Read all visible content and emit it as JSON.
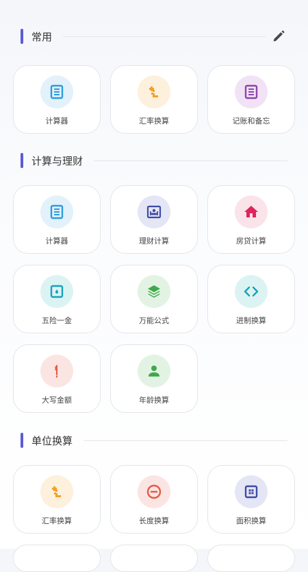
{
  "sections": {
    "common": {
      "title": "常用",
      "items": [
        "计算器",
        "汇率换算",
        "记账和备忘"
      ]
    },
    "calc_finance": {
      "title": "计算与理财",
      "items": [
        "计算器",
        "理财计算",
        "房贷计算",
        "五险一金",
        "万能公式",
        "进制换算",
        "大写金额",
        "年龄换算"
      ]
    },
    "units": {
      "title": "单位换算",
      "items": [
        "汇率换算",
        "长度换算",
        "面积换算"
      ]
    }
  },
  "colors": {
    "section_bar": "#5b5bd6",
    "blue": "#2d9cdb",
    "orange": "#f2a12a",
    "purple": "#8e44ad",
    "navy": "#3f4aa5",
    "pink": "#e0245e",
    "teal": "#17a2b8",
    "green": "#3fa94a",
    "red": "#e45a47"
  },
  "icons": {
    "edit": "pencil-icon",
    "calculator": "calculator-icon",
    "exchange": "exchange-icon",
    "notes": "notes-icon",
    "finance": "finance-icon",
    "mortgage": "house-icon",
    "insurance": "insurance-icon",
    "formula": "layers-icon",
    "base_convert": "code-brackets-icon",
    "capital_amount": "pen-icon",
    "age": "person-icon",
    "length": "minus-circle-icon",
    "area": "area-grid-icon"
  }
}
